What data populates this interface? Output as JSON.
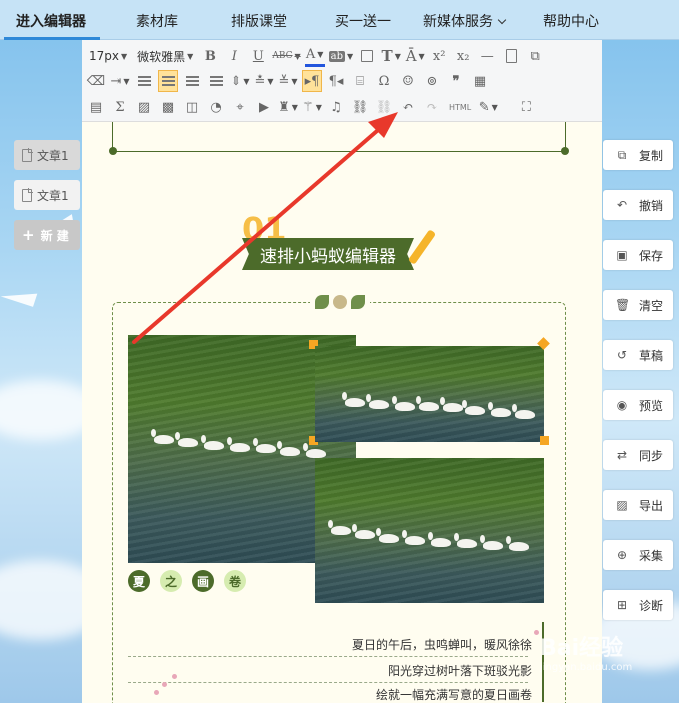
{
  "topnav": {
    "items": [
      {
        "label": "进入编辑器",
        "active": true
      },
      {
        "label": "素材库"
      },
      {
        "label": "排版课堂"
      },
      {
        "label": "买一送一"
      },
      {
        "label": "新媒体服务"
      },
      {
        "label": "帮助中心"
      }
    ]
  },
  "left_panel": {
    "docs": [
      {
        "label": "文章1"
      },
      {
        "label": "文章1"
      }
    ],
    "new_label": "新 建"
  },
  "right_panel": {
    "actions": [
      {
        "label": "复制",
        "icon": "copy-icon"
      },
      {
        "label": "撤销",
        "icon": "undo-icon"
      },
      {
        "label": "保存",
        "icon": "save-icon"
      },
      {
        "label": "清空",
        "icon": "trash-icon"
      },
      {
        "label": "草稿",
        "icon": "history-icon"
      },
      {
        "label": "预览",
        "icon": "eye-icon"
      },
      {
        "label": "同步",
        "icon": "sync-icon"
      },
      {
        "label": "导出",
        "icon": "export-image-icon"
      },
      {
        "label": "采集",
        "icon": "search-collect-icon"
      },
      {
        "label": "诊断",
        "icon": "plus-square-icon"
      }
    ]
  },
  "toolbar": {
    "font_size": "17px",
    "font_family": "微软雅黑",
    "bold": "B",
    "italic": "I",
    "underline": "U",
    "strike": "ABC",
    "font_color": "A",
    "bg_label": "ab",
    "html_label": "HTML",
    "superscript": "x²",
    "subscript": "x₂",
    "omega": "Ω"
  },
  "article": {
    "number": "01",
    "title": "速排小蚂蚁编辑器",
    "tags": [
      "夏",
      "之",
      "画",
      "卷"
    ],
    "poem": [
      "夏日的午后，虫鸣蝉叫，暖风徐徐",
      "阳光穿过树叶落下斑驳光影",
      "绘就一幅充满写意的夏日画卷"
    ]
  },
  "watermark": {
    "text": "Bai经验",
    "sub": "jingyan.baidu.com"
  },
  "colors": {
    "accent_green": "#4c6b2a",
    "accent_orange": "#f5a623",
    "arrow_red": "#e8382b",
    "nav_active": "#2f89d8"
  }
}
